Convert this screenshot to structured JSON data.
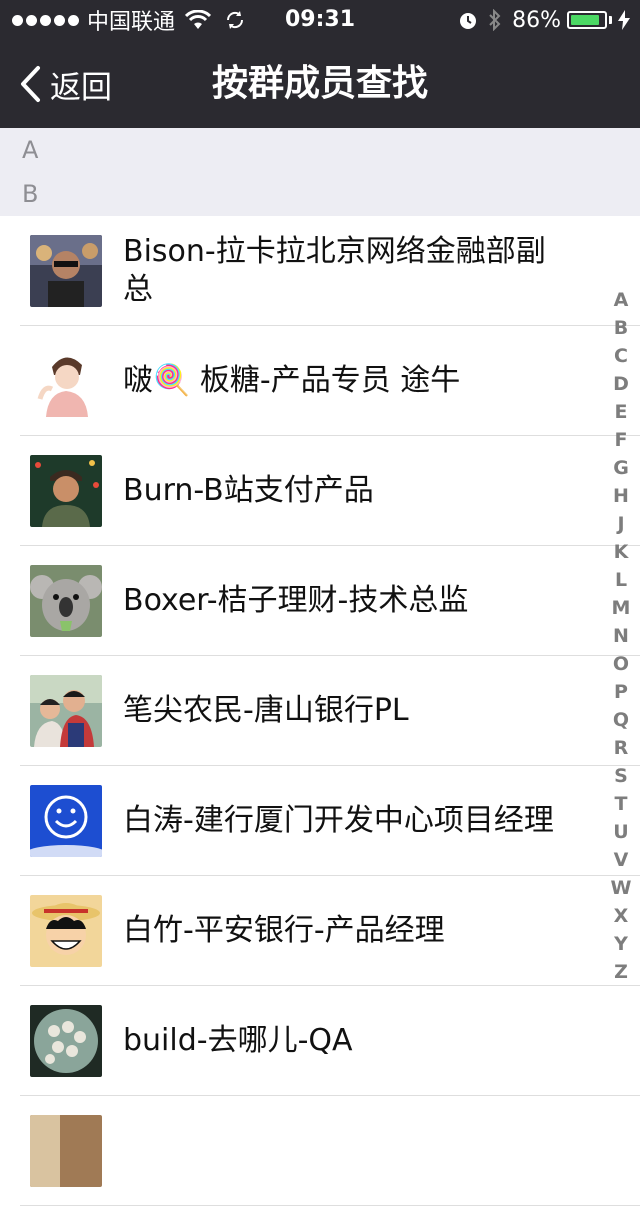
{
  "status_bar": {
    "carrier": "中国联通",
    "time": "09:31",
    "battery_percent": "86%",
    "battery_level": 0.86,
    "icons": [
      "signal-dots",
      "wifi-icon",
      "sync-icon",
      "alarm-icon",
      "bluetooth-icon",
      "battery-icon",
      "charging-icon"
    ]
  },
  "nav": {
    "back_label": "返回",
    "title": "按群成员查找"
  },
  "sections": [
    "A",
    "B"
  ],
  "members": [
    {
      "name": "Bison-拉卡拉北京网络金融部副总"
    },
    {
      "name": "啵🍭 板糖-产品专员 途牛"
    },
    {
      "name": "Burn-B站支付产品"
    },
    {
      "name": "Boxer-桔子理财-技术总监"
    },
    {
      "name": "笔尖农民-唐山银行PL"
    },
    {
      "name": "白涛-建行厦门开发中心项目经理"
    },
    {
      "name": "白竹-平安银行-产品经理"
    },
    {
      "name": "build-去哪儿-QA"
    },
    {
      "name": ""
    }
  ],
  "index": [
    "A",
    "B",
    "C",
    "D",
    "E",
    "F",
    "G",
    "H",
    "J",
    "K",
    "L",
    "M",
    "N",
    "O",
    "P",
    "Q",
    "R",
    "S",
    "T",
    "U",
    "V",
    "W",
    "X",
    "Y",
    "Z"
  ],
  "colors": {
    "bar_bg": "#2b2a30",
    "section_bg": "#ededf3",
    "battery_green": "#4cd964"
  }
}
